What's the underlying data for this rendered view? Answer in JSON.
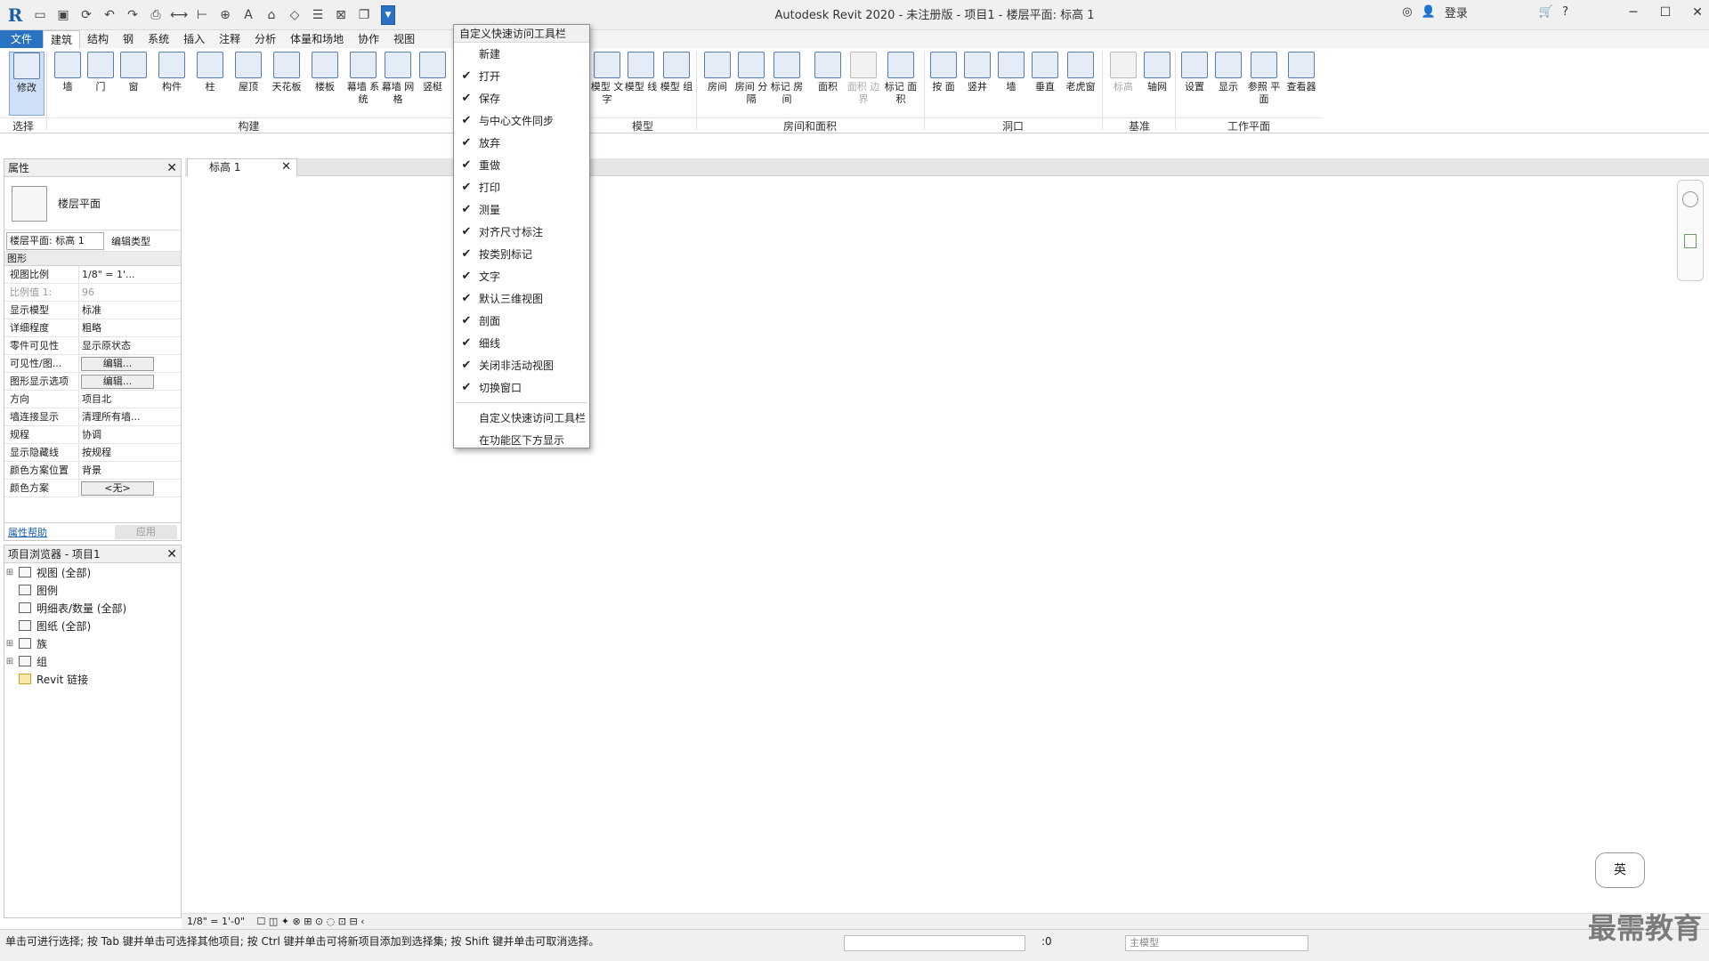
{
  "window": {
    "title": "Autodesk Revit 2020 - 未注册版 - 项目1 - 楼层平面: 标高 1",
    "login": "登录",
    "help": "?"
  },
  "qat": {
    "icons": [
      "revit-logo-icon",
      "open-icon",
      "save-icon",
      "sync-icon",
      "undo-icon",
      "redo-icon",
      "print-icon",
      "measure-icon",
      "dimension-icon",
      "text-icon",
      "3d-view-icon",
      "section-icon",
      "thin-lines-icon",
      "close-views-icon",
      "switch-window-icon",
      "customize-qat-dropdown-icon"
    ]
  },
  "ribbon": {
    "tabs": [
      "文件",
      "建筑",
      "结构",
      "钢",
      "系统",
      "插入",
      "注释",
      "分析",
      "体量和场地",
      "协作",
      "视图"
    ],
    "active_tab": "建筑",
    "tools_left": [
      {
        "label": "修改"
      },
      {
        "label": "墙"
      },
      {
        "label": "门"
      },
      {
        "label": "窗"
      },
      {
        "label": "构件"
      },
      {
        "label": "柱"
      },
      {
        "label": "屋顶"
      },
      {
        "label": "天花板"
      },
      {
        "label": "楼板"
      },
      {
        "label": "幕墙 系统"
      },
      {
        "label": "幕墙 网格"
      },
      {
        "label": "竖梃"
      }
    ],
    "tools_right": [
      {
        "label": "模型 文字"
      },
      {
        "label": "模型 线"
      },
      {
        "label": "模型 组"
      },
      {
        "label": "房间"
      },
      {
        "label": "房间 分隔"
      },
      {
        "label": "标记 房间"
      },
      {
        "label": "面积"
      },
      {
        "label": "面积 边界"
      },
      {
        "label": "标记 面积"
      },
      {
        "label": "按 面"
      },
      {
        "label": "竖井"
      },
      {
        "label": "墙"
      },
      {
        "label": "垂直"
      },
      {
        "label": "老虎窗"
      },
      {
        "label": "标高"
      },
      {
        "label": "轴网"
      },
      {
        "label": "设置"
      },
      {
        "label": "显示"
      },
      {
        "label": "参照 平面"
      },
      {
        "label": "查看器"
      }
    ],
    "panels": {
      "select": "选择",
      "build": "构建",
      "model": "模型",
      "room": "房间和面积",
      "opening": "洞口",
      "datum": "基准",
      "workplane": "工作平面"
    }
  },
  "properties": {
    "title": "属性",
    "type_name": "楼层平面",
    "selector": "楼层平面: 标高 1",
    "edit_type": "编辑类型",
    "group": "图形",
    "rows": [
      {
        "k": "视图比例",
        "v": "1/8\" = 1'..."
      },
      {
        "k": "比例值 1:",
        "v": "96"
      },
      {
        "k": "显示模型",
        "v": "标准"
      },
      {
        "k": "详细程度",
        "v": "粗略"
      },
      {
        "k": "零件可见性",
        "v": "显示原状态"
      },
      {
        "k": "可见性/图...",
        "v": "编辑..."
      },
      {
        "k": "图形显示选项",
        "v": "编辑..."
      },
      {
        "k": "方向",
        "v": "项目北"
      },
      {
        "k": "墙连接显示",
        "v": "清理所有墙..."
      },
      {
        "k": "规程",
        "v": "协调"
      },
      {
        "k": "显示隐藏线",
        "v": "按规程"
      },
      {
        "k": "颜色方案位置",
        "v": "背景"
      },
      {
        "k": "颜色方案",
        "v": "<无>"
      }
    ],
    "help": "属性帮助",
    "apply": "应用"
  },
  "browser": {
    "title": "项目浏览器 - 项目1",
    "items": [
      {
        "label": "视图 (全部)",
        "exp": "⊞"
      },
      {
        "label": "图例",
        "exp": ""
      },
      {
        "label": "明细表/数量 (全部)",
        "exp": ""
      },
      {
        "label": "图纸 (全部)",
        "exp": ""
      },
      {
        "label": "族",
        "exp": "⊞"
      },
      {
        "label": "组",
        "exp": "⊞"
      },
      {
        "label": "Revit 链接",
        "exp": ""
      }
    ]
  },
  "view": {
    "tab": "标高 1",
    "scale": "1/8\" = 1'-0\""
  },
  "menu": {
    "title": "自定义快速访问工具栏",
    "items": [
      {
        "label": "新建",
        "checked": false
      },
      {
        "label": "打开",
        "checked": true
      },
      {
        "label": "保存",
        "checked": true
      },
      {
        "label": "与中心文件同步",
        "checked": true
      },
      {
        "label": "放弃",
        "checked": true
      },
      {
        "label": "重做",
        "checked": true
      },
      {
        "label": "打印",
        "checked": true
      },
      {
        "label": "测量",
        "checked": true
      },
      {
        "label": "对齐尺寸标注",
        "checked": true
      },
      {
        "label": "按类别标记",
        "checked": true
      },
      {
        "label": "文字",
        "checked": true
      },
      {
        "label": "默认三维视图",
        "checked": true
      },
      {
        "label": "剖面",
        "checked": true
      },
      {
        "label": "细线",
        "checked": true
      },
      {
        "label": "关闭非活动视图",
        "checked": true
      },
      {
        "label": "切换窗口",
        "checked": true
      }
    ],
    "extra": [
      "自定义快速访问工具栏",
      "在功能区下方显示"
    ]
  },
  "status": {
    "message": "单击可进行选择; 按 Tab 键并单击可选择其他项目; 按 Ctrl 键并单击可将新项目添加到选择集; 按 Shift 键并单击可取消选择。",
    "zero": ":0",
    "model": "主模型"
  },
  "ime": "英",
  "watermark": "最需教育"
}
